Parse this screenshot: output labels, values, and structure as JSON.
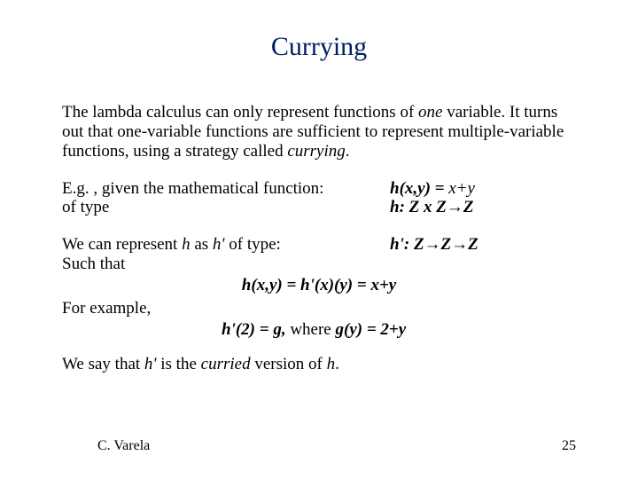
{
  "title": "Currying",
  "para1_a": "The lambda calculus can only represent functions of ",
  "para1_b": "one",
  "para1_c": " variable. It turns out that one-variable functions are sufficient to represent multiple-variable functions, using a strategy called ",
  "para1_d": "currying",
  "para1_e": ".",
  "row1_left_a": "E.g. , given the mathematical function:",
  "row1_left_b": "of type",
  "row1_right_a_pre": "h(x,y) = ",
  "row1_right_a_post": "x+y",
  "row1_right_b_pre": "h: ",
  "row1_right_b_mid1": "Z x Z",
  "row1_right_b_mid2": "Z",
  "row2_left_a": "We can represent ",
  "row2_left_b": "h",
  "row2_left_c": " as ",
  "row2_left_d": "h'",
  "row2_left_e": " of type:",
  "row2_left_f": "Such that",
  "row2_right_a_pre": "h': ",
  "row2_right_a_m1": "Z",
  "row2_right_a_m2": "Z",
  "row2_right_a_m3": "Z",
  "eq_center": "h(x,y) = h'(x)(y) = x+y",
  "for_example": "For example,",
  "eq_indent_a": "h'(2) = g, ",
  "eq_indent_b": "where ",
  "eq_indent_c": "g(y) = 2+y",
  "closing_a": "We say that ",
  "closing_b": "h'",
  "closing_c": " is the ",
  "closing_d": "curried",
  "closing_e": " version of ",
  "closing_f": "h",
  "closing_g": ".",
  "author": "C. Varela",
  "page": "25",
  "arrow": "→"
}
